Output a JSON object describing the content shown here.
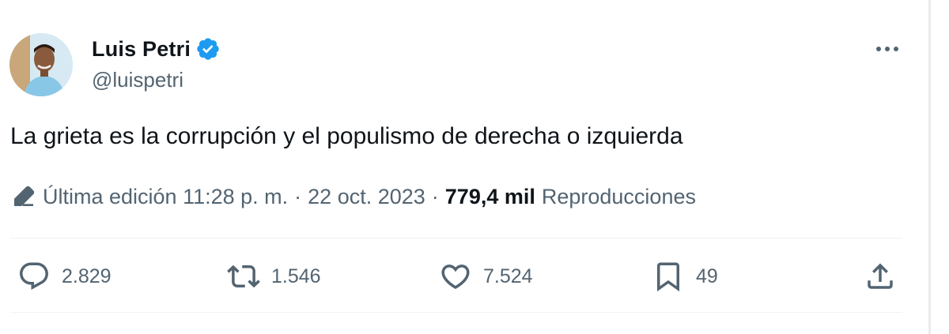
{
  "author": {
    "display_name": "Luis Petri",
    "handle": "@luispetri",
    "verified": true
  },
  "tweet": {
    "text": "La grieta es la corrupción y el populismo de derecha o izquierda"
  },
  "meta": {
    "edit_label": "Última edición 11:28 p. m.",
    "separator_1": "·",
    "date": "22 oct. 2023",
    "separator_2": "·",
    "views_count": "779,4 mil",
    "views_label": "Reproducciones"
  },
  "actions": {
    "replies": "2.829",
    "reposts": "1.546",
    "likes": "7.524",
    "bookmarks": "49"
  },
  "colors": {
    "text_primary": "#0f1419",
    "text_secondary": "#536471",
    "verified_blue": "#1d9bf0",
    "divider": "#eff3f4"
  },
  "icons": [
    "more-icon",
    "verified-badge-icon",
    "edit-icon",
    "reply-icon",
    "repost-icon",
    "like-icon",
    "bookmark-icon",
    "share-icon"
  ]
}
